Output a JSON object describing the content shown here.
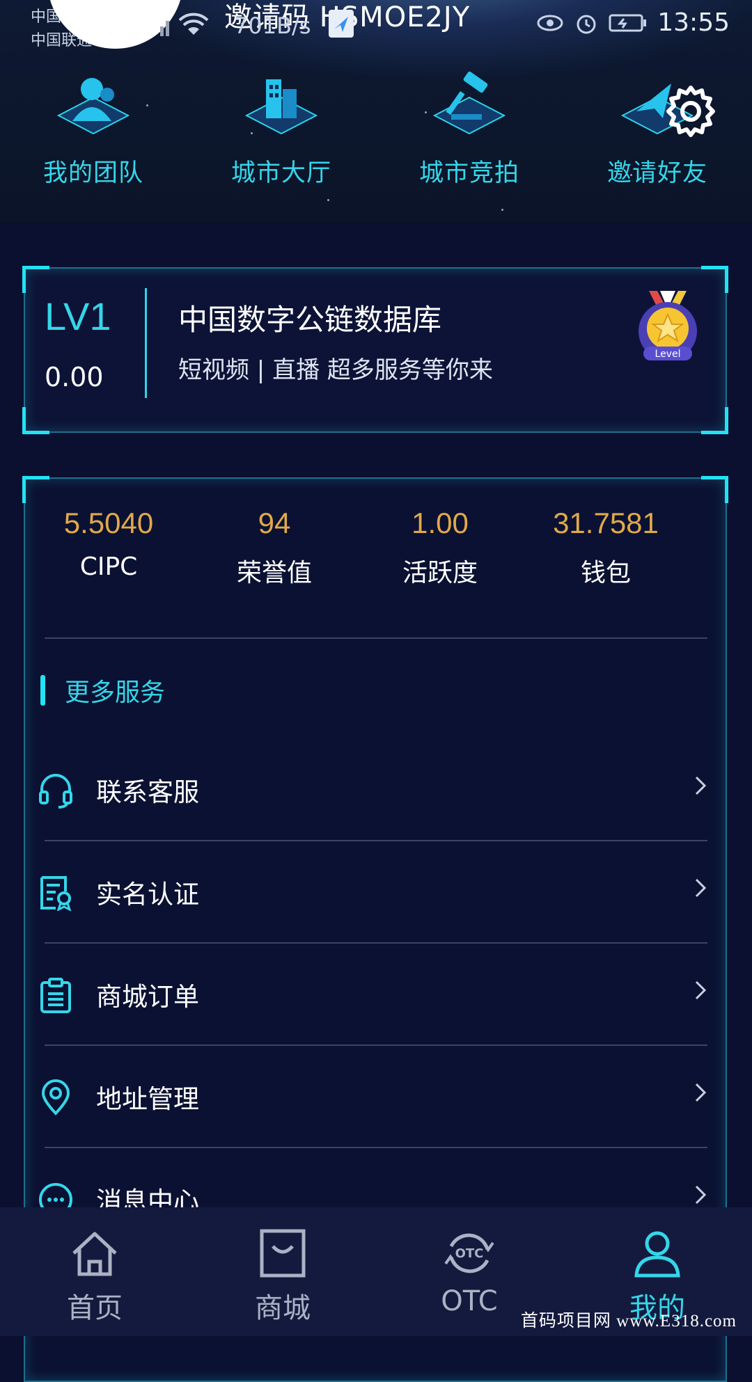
{
  "status_bar": {
    "carrier_1": "中国",
    "carrier_2": "中国联通",
    "invite_text": "邀请码 HSMOE2JY",
    "net_speed": "701B/s",
    "time": "13:55"
  },
  "shortcuts": [
    {
      "label": "我的团队",
      "icon": "team-icon"
    },
    {
      "label": "城市大厅",
      "icon": "city-hall-icon"
    },
    {
      "label": "城市竞拍",
      "icon": "auction-gavel-icon"
    },
    {
      "label": "邀请好友",
      "icon": "invite-friends-icon"
    }
  ],
  "level_card": {
    "level": "LV1",
    "value": "0.00",
    "title": "中国数字公链数据库",
    "subtitle": "短视频 | 直播 超多服务等你来",
    "badge_text": "Level"
  },
  "stats": [
    {
      "value": "5.5040",
      "label": "CIPC"
    },
    {
      "value": "94",
      "label": "荣誉值"
    },
    {
      "value": "1.00",
      "label": "活跃度"
    },
    {
      "value": "31.7581",
      "label": "钱包"
    }
  ],
  "services": {
    "section_title": "更多服务",
    "items": [
      {
        "label": "联系客服",
        "icon": "headset-icon"
      },
      {
        "label": "实名认证",
        "icon": "certificate-icon"
      },
      {
        "label": "商城订单",
        "icon": "clipboard-icon"
      },
      {
        "label": "地址管理",
        "icon": "location-pin-icon"
      },
      {
        "label": "消息中心",
        "icon": "message-icon"
      }
    ]
  },
  "bottom_nav": {
    "tabs": [
      {
        "label": "首页",
        "icon": "home-icon",
        "active": false
      },
      {
        "label": "商城",
        "icon": "shopping-bag-icon",
        "active": false
      },
      {
        "label": "OTC",
        "icon": "otc-icon",
        "active": false
      },
      {
        "label": "我的",
        "icon": "user-icon",
        "active": true
      }
    ]
  },
  "watermark": "首码项目网 www.E318.com",
  "colors": {
    "accent": "#35d6e9",
    "stat_value": "#e0a94a",
    "background": "#0b1030"
  }
}
